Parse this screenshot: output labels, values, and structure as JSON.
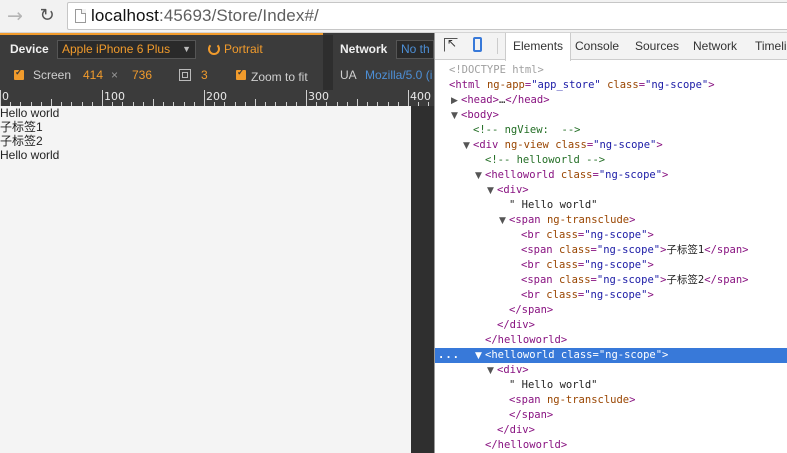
{
  "address_bar": {
    "url_host": "localhost",
    "url_rest": ":45693/Store/Index#/"
  },
  "emulation": {
    "device_label": "Device",
    "device_value": "Apple iPhone 6 Plus",
    "orientation_label": "Portrait",
    "network_label": "Network",
    "network_value": "No th",
    "screen_label": "Screen",
    "screen_width": "414",
    "screen_x": "×",
    "screen_height": "736",
    "dpr_value": "3",
    "zoom_label": "Zoom to fit",
    "ua_label": "UA",
    "ua_value": "Mozilla/5.0 (i",
    "accent_color": "#f19b2c"
  },
  "ruler": {
    "labels": [
      "0",
      "100",
      "200",
      "300",
      "400"
    ]
  },
  "viewport": {
    "lines": [
      "Hello world",
      "子标签1",
      "子标签2",
      "Hello world"
    ]
  },
  "devtools": {
    "tabs": [
      "Elements",
      "Console",
      "Sources",
      "Network",
      "Timeline"
    ],
    "dom": {
      "r0": {
        "doctype": "<!DOCTYPE html>"
      },
      "r1": {
        "o": "<html",
        "a1": "ng-app",
        "v1": "\"app_store\"",
        "a2": "class",
        "v2": "\"ng-scope\"",
        "c": ">"
      },
      "r2": {
        "o": "<head>",
        "m": "…",
        "c": "</head>"
      },
      "r3": {
        "o": "<body>"
      },
      "r4": {
        "comment": "<!-- ngView:  -->"
      },
      "r5": {
        "o": "<div",
        "a1": "ng-view",
        "a2": "class",
        "v2": "\"ng-scope\"",
        "c": ">"
      },
      "r6": {
        "comment": "<!-- helloworld -->"
      },
      "r7": {
        "o": "<helloworld",
        "a2": "class",
        "v2": "\"ng-scope\"",
        "c": ">"
      },
      "r8": {
        "o": "<div>"
      },
      "r9": {
        "text": "\" Hello world\""
      },
      "r10": {
        "o": "<span",
        "a1": "ng-transclude",
        "c": ">"
      },
      "r11": {
        "o": "<br",
        "a2": "class",
        "v2": "\"ng-scope\"",
        "c": ">"
      },
      "r12": {
        "o": "<span",
        "a2": "class",
        "v2": "\"ng-scope\"",
        "c": ">",
        "text": "子标签1",
        "e": "</span>"
      },
      "r13": {
        "o": "<br",
        "a2": "class",
        "v2": "\"ng-scope\"",
        "c": ">"
      },
      "r14": {
        "o": "<span",
        "a2": "class",
        "v2": "\"ng-scope\"",
        "c": ">",
        "text": "子标签2",
        "e": "</span>"
      },
      "r15": {
        "o": "<br",
        "a2": "class",
        "v2": "\"ng-scope\"",
        "c": ">"
      },
      "r16": {
        "e": "</span>"
      },
      "r17": {
        "e": "</div>"
      },
      "r18": {
        "e": "</helloworld>"
      },
      "r19": {
        "ellipsis": "...",
        "o": "<helloworld",
        "a2": "class",
        "v2": "\"ng-scope\"",
        "c": ">"
      },
      "r20": {
        "o": "<div>"
      },
      "r21": {
        "text": "\" Hello world\""
      },
      "r22": {
        "o": "<span",
        "a1": "ng-transclude",
        "c": ">"
      },
      "r23": {
        "e": "</span>"
      },
      "r24": {
        "e": "</div>"
      },
      "r25": {
        "e": "</helloworld>"
      }
    }
  }
}
